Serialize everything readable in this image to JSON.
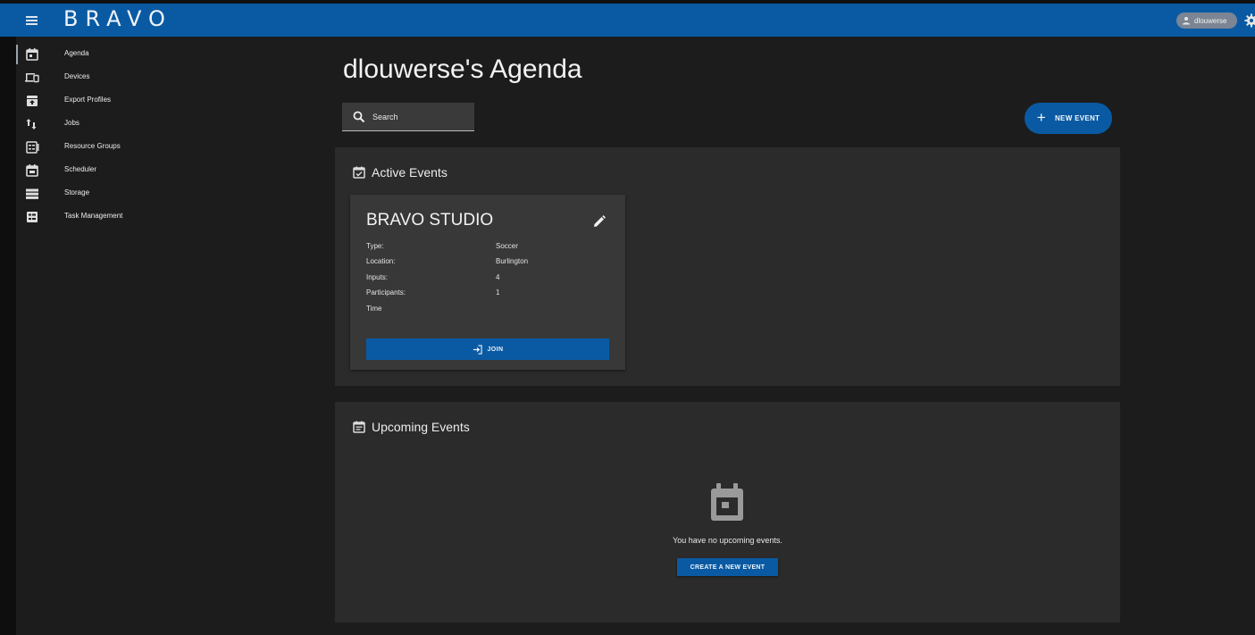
{
  "app": {
    "logo": "BRAVO"
  },
  "header": {
    "user": "dlouwerse"
  },
  "sidebar": {
    "items": [
      {
        "label": "Agenda",
        "icon": "calendar-icon",
        "active": true
      },
      {
        "label": "Devices",
        "icon": "devices-icon"
      },
      {
        "label": "Export Profiles",
        "icon": "archive-icon"
      },
      {
        "label": "Jobs",
        "icon": "swap-vertical-icon"
      },
      {
        "label": "Resource Groups",
        "icon": "resource-groups-icon"
      },
      {
        "label": "Scheduler",
        "icon": "calendar-icon"
      },
      {
        "label": "Storage",
        "icon": "storage-icon"
      },
      {
        "label": "Task Management",
        "icon": "task-list-icon"
      }
    ]
  },
  "main": {
    "title": "dlouwerse's Agenda",
    "search_placeholder": "Search",
    "new_event_label": "NEW EVENT",
    "active_events": {
      "title": "Active Events",
      "cards": [
        {
          "name": "BRAVO STUDIO",
          "rows": [
            {
              "label": "Type:",
              "value": "Soccer"
            },
            {
              "label": "Location:",
              "value": "Burlington"
            },
            {
              "label": "Inputs:",
              "value": "4"
            },
            {
              "label": "Participants:",
              "value": "1"
            },
            {
              "label": "Time",
              "value": ""
            }
          ],
          "join_label": "JOIN"
        }
      ]
    },
    "upcoming_events": {
      "title": "Upcoming Events",
      "empty_text": "You have no upcoming events.",
      "create_label": "CREATE A NEW EVENT"
    }
  },
  "colors": {
    "primary": "#0a5aa3",
    "background": "#1c1c1c",
    "panel": "#2b2b2b",
    "card": "#383838"
  }
}
